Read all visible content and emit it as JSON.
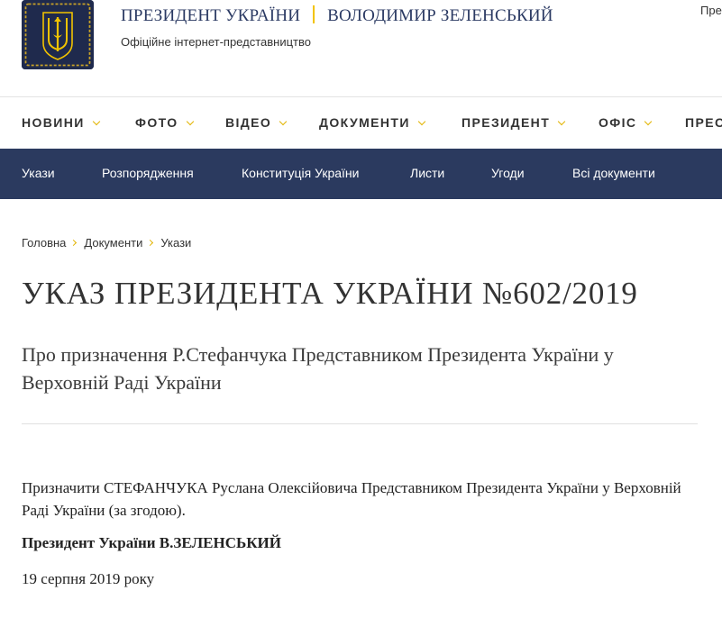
{
  "header": {
    "title_left": "ПРЕЗИДЕНТ УКРАЇНИ",
    "title_right": "ВОЛОДИМИР ЗЕЛЕНСЬКИЙ",
    "subtitle": "Офіційне інтернет-представництво",
    "top_right_cut": "Пре"
  },
  "main_nav": {
    "items": [
      {
        "label": "НОВИНИ"
      },
      {
        "label": "ФОТО"
      },
      {
        "label": "ВІДЕО"
      },
      {
        "label": "ДОКУМЕНТИ"
      },
      {
        "label": "ПРЕЗИДЕНТ"
      },
      {
        "label": "ОФІС"
      },
      {
        "label": "ПРЕС"
      }
    ]
  },
  "sub_nav": {
    "items": [
      {
        "label": "Укази"
      },
      {
        "label": "Розпорядження"
      },
      {
        "label": "Конституція України"
      },
      {
        "label": "Листи"
      },
      {
        "label": "Угоди"
      },
      {
        "label": "Всі документи"
      }
    ]
  },
  "breadcrumb": [
    "Головна",
    "Документи",
    "Укази"
  ],
  "document": {
    "title": "УКАЗ ПРЕЗИДЕНТА УКРАЇНИ №602/2019",
    "subtitle": "Про призначення Р.Стефанчука Представником Президента України у Верховній Раді України",
    "body": "Призначити СТЕФАНЧУКА Руслана Олексійовича Представником Президента України у Верховній Раді України (за згодою).",
    "signature": "Президент України В.ЗЕЛЕНСЬКИЙ",
    "date": "19 серпня 2019 року"
  },
  "colors": {
    "navy": "#2b3a5f",
    "logo_bg": "#1f2a4d",
    "gold": "#f2c300",
    "text": "#333333"
  },
  "icons": {
    "logo": "coat-of-arms-trident-icon",
    "nav_chevron": "chevron-down-icon",
    "breadcrumb_separator": "chevron-right-icon"
  }
}
